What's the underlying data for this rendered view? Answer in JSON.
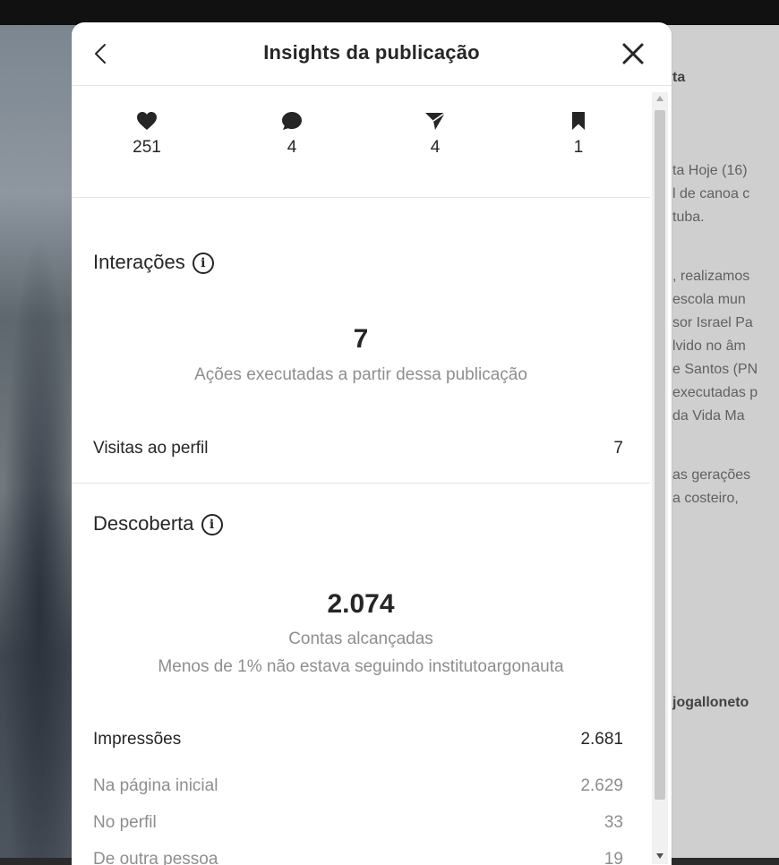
{
  "modal": {
    "title": "Insights da publicação"
  },
  "stats": [
    {
      "icon": "heart-icon",
      "value": "251"
    },
    {
      "icon": "comment-icon",
      "value": "4"
    },
    {
      "icon": "share-icon",
      "value": "4"
    },
    {
      "icon": "bookmark-icon",
      "value": "1"
    }
  ],
  "interactions": {
    "title": "Interações",
    "total": "7",
    "caption": "Ações executadas a partir dessa publicação",
    "rows": [
      {
        "label": "Visitas ao perfil",
        "value": "7"
      }
    ]
  },
  "discovery": {
    "title": "Descoberta",
    "total": "2.074",
    "caption": "Contas alcançadas",
    "subcaption": "Menos de 1% não estava seguindo institutoargonauta",
    "impressions": {
      "label": "Impressões",
      "value": "2.681"
    },
    "breakdown": [
      {
        "label": "Na página inicial",
        "value": "2.629"
      },
      {
        "label": "No perfil",
        "value": "33"
      },
      {
        "label": "De outra pessoa",
        "value": "19"
      }
    ]
  },
  "background_right": {
    "lines": [
      "ta",
      "ta Hoje (16)",
      "l de canoa c",
      "tuba.",
      ", realizamos",
      "escola mun",
      "sor Israel Pa",
      "lvido no âm",
      "e Santos (PN",
      "executadas p",
      "da Vida Ma",
      "as gerações",
      "a costeiro,",
      "jogalloneto"
    ]
  },
  "colors": {
    "text_primary": "#262626",
    "text_secondary": "#8e8e8e",
    "divider": "#e4e4e4"
  }
}
